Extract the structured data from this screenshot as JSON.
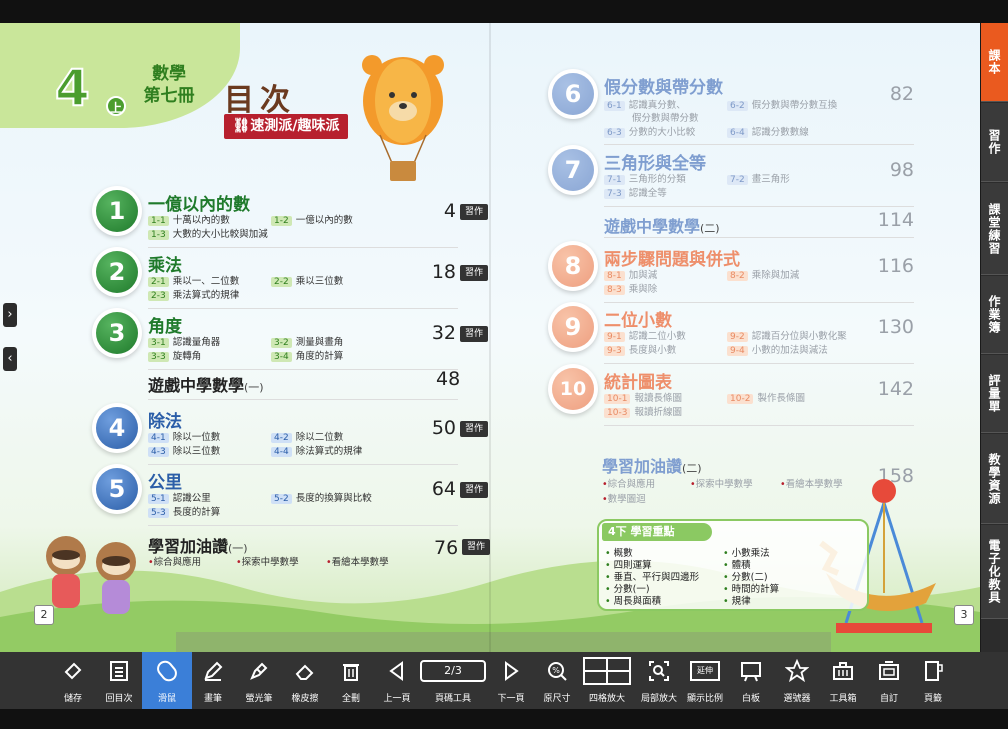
{
  "left_page": {
    "grade": "4",
    "grade_sub": "上",
    "book_title_line1": "數學",
    "book_title_line2": "第七冊",
    "toc_title": "目次",
    "tag_link": "速測派/趣味派",
    "page_number": "2",
    "chapters": [
      {
        "num": "1",
        "title": "一億以內的數",
        "page": "4",
        "hw": "習作",
        "lessons": [
          {
            "code": "1-1",
            "text": "十萬以內的數"
          },
          {
            "code": "1-2",
            "text": "一億以內的數"
          },
          {
            "code": "1-3",
            "text": "大數的大小比較與加減"
          }
        ]
      },
      {
        "num": "2",
        "title": "乘法",
        "page": "18",
        "hw": "習作",
        "lessons": [
          {
            "code": "2-1",
            "text": "乘以一、二位數"
          },
          {
            "code": "2-2",
            "text": "乘以三位數"
          },
          {
            "code": "2-3",
            "text": "乘法算式的規律"
          }
        ]
      },
      {
        "num": "3",
        "title": "角度",
        "page": "32",
        "hw": "習作",
        "lessons": [
          {
            "code": "3-1",
            "text": "認識量角器"
          },
          {
            "code": "3-2",
            "text": "測量與畫角"
          },
          {
            "code": "3-3",
            "text": "旋轉角"
          },
          {
            "code": "3-4",
            "text": "角度的計算"
          }
        ]
      },
      {
        "num": "4",
        "title": "除法",
        "page": "50",
        "hw": "習作",
        "lessons": [
          {
            "code": "4-1",
            "text": "除以一位數"
          },
          {
            "code": "4-2",
            "text": "除以二位數"
          },
          {
            "code": "4-3",
            "text": "除以三位數"
          },
          {
            "code": "4-4",
            "text": "除法算式的規律"
          }
        ]
      },
      {
        "num": "5",
        "title": "公里",
        "page": "64",
        "hw": "習作",
        "lessons": [
          {
            "code": "5-1",
            "text": "認識公里"
          },
          {
            "code": "5-2",
            "text": "長度的換算與比較"
          },
          {
            "code": "5-3",
            "text": "長度的計算"
          }
        ]
      }
    ],
    "game_section": {
      "title": "遊戲中學數學",
      "sub": "(一)",
      "page": "48"
    },
    "extra_section": {
      "title": "學習加油讚",
      "sub": "(一)",
      "page": "76",
      "hw": "習作",
      "items": [
        "綜合與應用",
        "探索中學數學",
        "看繪本學數學"
      ]
    }
  },
  "right_page": {
    "page_number": "3",
    "chapters": [
      {
        "num": "6",
        "title": "假分數與帶分數",
        "page": "82",
        "lessons": [
          {
            "code": "6-1",
            "text": "認識真分數、"
          },
          {
            "code": "6-2",
            "text": "假分數與帶分數互換"
          },
          {
            "code": "",
            "text": "假分數與帶分數"
          },
          {
            "code": "6-3",
            "text": "分數的大小比較"
          },
          {
            "code": "6-4",
            "text": "認識分數數線"
          }
        ]
      },
      {
        "num": "7",
        "title": "三角形與全等",
        "page": "98",
        "lessons": [
          {
            "code": "7-1",
            "text": "三角形的分類"
          },
          {
            "code": "7-2",
            "text": "畫三角形"
          },
          {
            "code": "7-3",
            "text": "認識全等"
          }
        ]
      },
      {
        "num": "8",
        "title": "兩步驟問題與併式",
        "page": "116",
        "lessons": [
          {
            "code": "8-1",
            "text": "加與減"
          },
          {
            "code": "8-2",
            "text": "乘除與加減"
          },
          {
            "code": "8-3",
            "text": "乘與除"
          }
        ]
      },
      {
        "num": "9",
        "title": "二位小數",
        "page": "130",
        "lessons": [
          {
            "code": "9-1",
            "text": "認識二位小數"
          },
          {
            "code": "9-2",
            "text": "認識百分位與小數化聚"
          },
          {
            "code": "9-3",
            "text": "長度與小數"
          },
          {
            "code": "9-4",
            "text": "小數的加法與減法"
          }
        ]
      },
      {
        "num": "10",
        "title": "統計圖表",
        "page": "142",
        "lessons": [
          {
            "code": "10-1",
            "text": "報讀長條圖"
          },
          {
            "code": "10-2",
            "text": "製作長條圖"
          },
          {
            "code": "10-3",
            "text": "報讀折線圖"
          }
        ]
      }
    ],
    "game_section": {
      "title": "遊戲中學數學",
      "sub": "(二)",
      "page": "114"
    },
    "extra_section": {
      "title": "學習加油讚",
      "sub": "(二)",
      "page": "158",
      "items": [
        "綜合與應用",
        "探索中學數學",
        "看繪本學數學",
        "數學圖迴"
      ]
    },
    "summary": {
      "title": "4下 學習重點",
      "left": [
        "概數",
        "四則運算",
        "垂直、平行與四邊形",
        "分數(一)",
        "周長與面積"
      ],
      "right": [
        "小數乘法",
        "體積",
        "分數(二)",
        "時間的計算",
        "規律"
      ]
    }
  },
  "side_tabs": [
    "課本",
    "習作",
    "課堂練習",
    "作業簿",
    "評量單",
    "教學資源",
    "電子化教具"
  ],
  "toolbar": {
    "page_indicator": "2/3",
    "tools": [
      "儲存",
      "回目次",
      "滑鼠",
      "畫筆",
      "螢光筆",
      "橡皮擦",
      "全刪",
      "上一頁",
      "頁碼工具",
      "下一頁",
      "原尺寸",
      "四格放大",
      "局部放大",
      "顯示比例",
      "白板",
      "選號器",
      "工具箱",
      "自訂",
      "頁籤"
    ],
    "display_ratio_label": "延伸"
  },
  "colors": {
    "accent": "#ea5a1f",
    "green": "#1f7a2b",
    "blue": "#2b5ea8",
    "tool_active": "#3b7fd8"
  }
}
